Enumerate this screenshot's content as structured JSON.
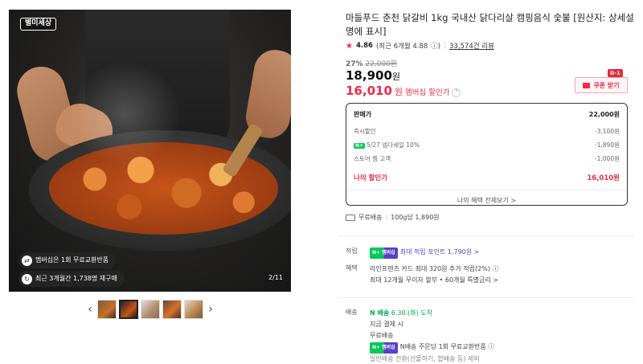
{
  "gallery": {
    "logo_text": "별미세상",
    "badges": [
      {
        "icon": "exchange-icon",
        "text": "멤버십은 1회 무료교환반품"
      },
      {
        "icon": "repurchase-icon",
        "text": "최근 3개월간 1,738명 재구매"
      }
    ],
    "counter": "2/11",
    "thumb_count": 5,
    "active_thumb": 1
  },
  "product": {
    "title": "마들푸드 춘천 닭갈비 1kg 국내산 닭다리살 캠핑음식 숯불 [원산지: 상세설명에 표시]",
    "rating": "4.86",
    "rating_detail": "(최근 6개월 4.88",
    "review_count": "33,574건 리뷰",
    "discount_pct": "27%",
    "original_price": "22,000원",
    "price": "18,900",
    "price_unit": "원",
    "member_price": "16,010",
    "member_unit": "원",
    "member_label": "멤버십 할인가",
    "coupon_label": "쿠폰 받기",
    "dday": "D-1"
  },
  "breakdown": {
    "head": {
      "label": "판매가",
      "value": "22,000원"
    },
    "rows": [
      {
        "label": "즉시할인",
        "value": "-3,100원",
        "badge": ""
      },
      {
        "label": "5/27 넴다세일 10%",
        "value": "-1,890원",
        "badge": "N+"
      },
      {
        "label": "스토어 찜 고객",
        "value": "-1,000원",
        "badge": ""
      }
    ],
    "mine": {
      "label": "나의 할인가",
      "value": "16,010원"
    },
    "all_benefits": "나의 혜택 전체보기 >"
  },
  "shipping_summary": {
    "label": "무료배송",
    "unit_price": "100g당 1,890원"
  },
  "points": {
    "key": "적립",
    "badge": "N+ 멤버십",
    "text": "최대 적립 포인트 1,790원 >"
  },
  "benefits": {
    "key": "혜택",
    "lines": [
      "라인프렌즈 카드 최대 320원 추가 적립(2%) ⓘ",
      "최대 12개월 무이자 할부 • 60개월 특별금리 >"
    ]
  },
  "delivery": {
    "key": "배송",
    "badge": "N 배송",
    "arrival": "6.30.(화) 도착",
    "lines": [
      "지금 결제 시",
      "무료배송"
    ],
    "member_badge": "N+ 멤버십",
    "member_text": "N배송 주문당 1회 무료교환반품 ⓘ",
    "note": "일반배송 전환(선물하기, 합배송 등) 제외"
  },
  "colors": {
    "accent": "#f02b45",
    "npay_green": "#03c75a",
    "membership_purple": "#5b3ec9"
  }
}
